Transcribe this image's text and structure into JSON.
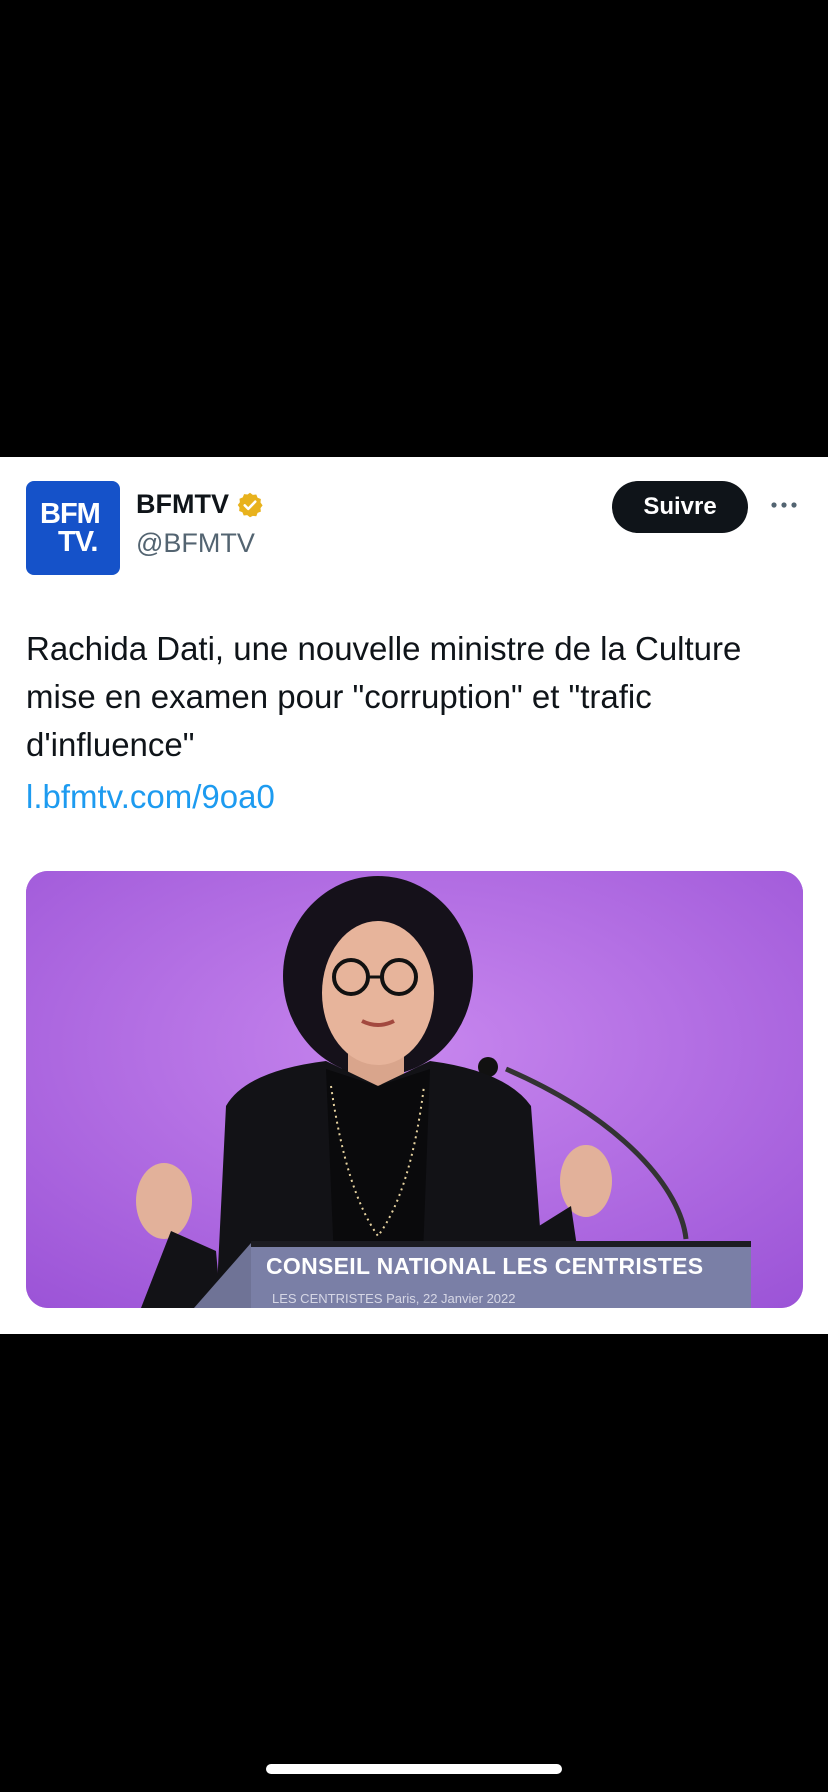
{
  "tweet": {
    "avatar_text_line1": "BFM",
    "avatar_text_line2": "TV.",
    "display_name": "BFMTV",
    "handle": "@BFMTV",
    "follow_label": "Suivre",
    "text": "Rachida Dati, une nouvelle ministre de la Culture mise en examen pour \"corruption\" et \"trafic d'influence\"",
    "link": "l.bfmtv.com/9oa0",
    "media": {
      "podium_title": "CONSEIL NATIONAL LES CENTRISTES",
      "podium_subtitle": "LES CENTRISTES     Paris, 22 Janvier 2022"
    }
  },
  "colors": {
    "avatar_bg": "#1552c9",
    "verified_badge": "#e8b21d",
    "link": "#1d9bf0",
    "follow_button_bg": "#0f1419",
    "media_bg": "#a05ad8"
  },
  "icons": [
    "verified-badge-icon",
    "more-options-icon"
  ]
}
